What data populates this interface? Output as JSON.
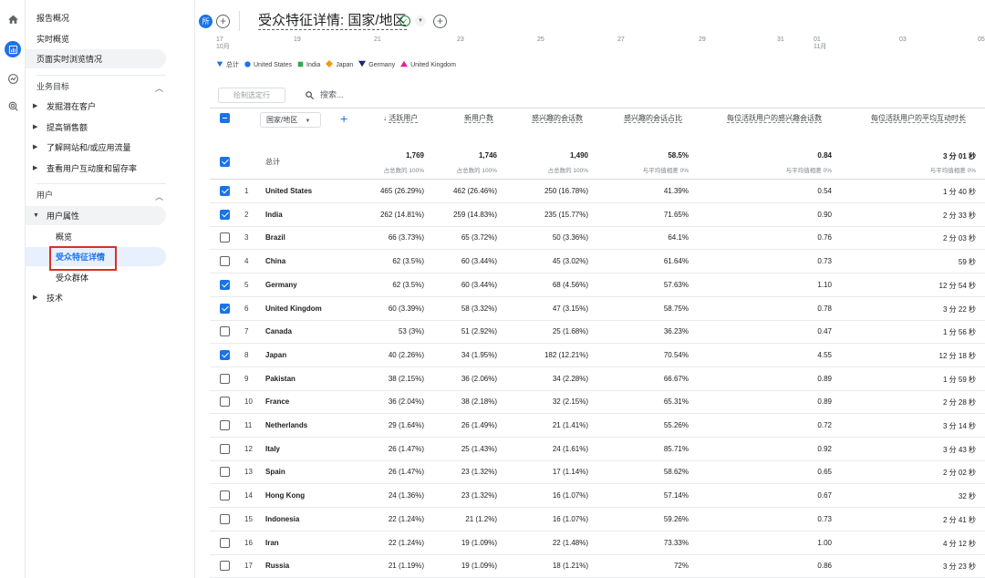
{
  "nav": {
    "top_items": [
      "报告概况",
      "实时概览",
      "页面实时浏览情况"
    ],
    "business": {
      "label": "业务目标",
      "items": [
        "发掘潜在客户",
        "提高销售额",
        "了解网站和/或应用流量",
        "查看用户互动度和留存率"
      ]
    },
    "user": {
      "label": "用户",
      "attr_label": "用户属性",
      "sub_items": [
        "概览",
        "受众特征详情",
        "受众群体"
      ],
      "tech_label": "技术"
    }
  },
  "header": {
    "badge": "所",
    "title": "受众特征详情: 国家/地区"
  },
  "timeline": {
    "ticks": [
      {
        "label": "17",
        "sub": "10月"
      },
      {
        "label": "19",
        "sub": ""
      },
      {
        "label": "21",
        "sub": ""
      },
      {
        "label": "23",
        "sub": ""
      },
      {
        "label": "25",
        "sub": ""
      },
      {
        "label": "27",
        "sub": ""
      },
      {
        "label": "29",
        "sub": ""
      },
      {
        "label": "31",
        "sub": ""
      },
      {
        "label": "01",
        "sub": "11月"
      },
      {
        "label": "03",
        "sub": ""
      },
      {
        "label": "05",
        "sub": ""
      }
    ],
    "legend": [
      {
        "name": "总计",
        "color": "#1a73e8",
        "marker": "pin"
      },
      {
        "name": "United States",
        "color": "#1a73e8",
        "marker": "circle"
      },
      {
        "name": "India",
        "color": "#34a853",
        "marker": "square"
      },
      {
        "name": "Japan",
        "color": "#f29900",
        "marker": "diamond"
      },
      {
        "name": "Germany",
        "color": "#1a237e",
        "marker": "tri-down"
      },
      {
        "name": "United Kingdom",
        "color": "#e52592",
        "marker": "tri-up"
      }
    ]
  },
  "toolbar": {
    "plot_rows": "绘制选定行",
    "search_placeholder": "搜索..."
  },
  "table": {
    "dimension": "国家/地区",
    "headers": [
      "活跃用户",
      "新用户数",
      "感兴趣的会话数",
      "感兴趣的会话占比",
      "每位活跃用户的感兴趣会话数",
      "每位活跃用户的平均互动时长"
    ],
    "sort_arrow": "↓",
    "totals": {
      "label": "总计",
      "values": [
        "1,769",
        "1,746",
        "1,490",
        "58.5%",
        "0.84",
        "3 分 01 秒"
      ],
      "subs": [
        "占总数的 100%",
        "占总数的 100%",
        "占总数的 100%",
        "与平均值相差 0%",
        "与平均值相差 0%",
        "与平均值相差 0%"
      ]
    },
    "rows": [
      {
        "idx": "1",
        "name": "United States",
        "checked": true,
        "values": [
          "465 (26.29%)",
          "462 (26.46%)",
          "250 (16.78%)",
          "41.39%",
          "0.54",
          "1 分 40 秒"
        ]
      },
      {
        "idx": "2",
        "name": "India",
        "checked": true,
        "values": [
          "262 (14.81%)",
          "259 (14.83%)",
          "235 (15.77%)",
          "71.65%",
          "0.90",
          "2 分 33 秒"
        ]
      },
      {
        "idx": "3",
        "name": "Brazil",
        "checked": false,
        "values": [
          "66 (3.73%)",
          "65 (3.72%)",
          "50 (3.36%)",
          "64.1%",
          "0.76",
          "2 分 03 秒"
        ]
      },
      {
        "idx": "4",
        "name": "China",
        "checked": false,
        "values": [
          "62 (3.5%)",
          "60 (3.44%)",
          "45 (3.02%)",
          "61.64%",
          "0.73",
          "59 秒"
        ]
      },
      {
        "idx": "5",
        "name": "Germany",
        "checked": true,
        "values": [
          "62 (3.5%)",
          "60 (3.44%)",
          "68 (4.56%)",
          "57.63%",
          "1.10",
          "12 分 54 秒"
        ]
      },
      {
        "idx": "6",
        "name": "United Kingdom",
        "checked": true,
        "values": [
          "60 (3.39%)",
          "58 (3.32%)",
          "47 (3.15%)",
          "58.75%",
          "0.78",
          "3 分 22 秒"
        ]
      },
      {
        "idx": "7",
        "name": "Canada",
        "checked": false,
        "values": [
          "53 (3%)",
          "51 (2.92%)",
          "25 (1.68%)",
          "36.23%",
          "0.47",
          "1 分 56 秒"
        ]
      },
      {
        "idx": "8",
        "name": "Japan",
        "checked": true,
        "values": [
          "40 (2.26%)",
          "34 (1.95%)",
          "182 (12.21%)",
          "70.54%",
          "4.55",
          "12 分 18 秒"
        ]
      },
      {
        "idx": "9",
        "name": "Pakistan",
        "checked": false,
        "values": [
          "38 (2.15%)",
          "36 (2.06%)",
          "34 (2.28%)",
          "66.67%",
          "0.89",
          "1 分 59 秒"
        ]
      },
      {
        "idx": "10",
        "name": "France",
        "checked": false,
        "values": [
          "36 (2.04%)",
          "38 (2.18%)",
          "32 (2.15%)",
          "65.31%",
          "0.89",
          "2 分 28 秒"
        ]
      },
      {
        "idx": "11",
        "name": "Netherlands",
        "checked": false,
        "values": [
          "29 (1.64%)",
          "26 (1.49%)",
          "21 (1.41%)",
          "55.26%",
          "0.72",
          "3 分 14 秒"
        ]
      },
      {
        "idx": "12",
        "name": "Italy",
        "checked": false,
        "values": [
          "26 (1.47%)",
          "25 (1.43%)",
          "24 (1.61%)",
          "85.71%",
          "0.92",
          "3 分 43 秒"
        ]
      },
      {
        "idx": "13",
        "name": "Spain",
        "checked": false,
        "values": [
          "26 (1.47%)",
          "23 (1.32%)",
          "17 (1.14%)",
          "58.62%",
          "0.65",
          "2 分 02 秒"
        ]
      },
      {
        "idx": "14",
        "name": "Hong Kong",
        "checked": false,
        "values": [
          "24 (1.36%)",
          "23 (1.32%)",
          "16 (1.07%)",
          "57.14%",
          "0.67",
          "32 秒"
        ]
      },
      {
        "idx": "15",
        "name": "Indonesia",
        "checked": false,
        "values": [
          "22 (1.24%)",
          "21 (1.2%)",
          "16 (1.07%)",
          "59.26%",
          "0.73",
          "2 分 41 秒"
        ]
      },
      {
        "idx": "16",
        "name": "Iran",
        "checked": false,
        "values": [
          "22 (1.24%)",
          "19 (1.09%)",
          "22 (1.48%)",
          "73.33%",
          "1.00",
          "4 分 12 秒"
        ]
      },
      {
        "idx": "17",
        "name": "Russia",
        "checked": false,
        "values": [
          "21 (1.19%)",
          "19 (1.09%)",
          "18 (1.21%)",
          "72%",
          "0.86",
          "3 分 23 秒"
        ]
      }
    ]
  },
  "colors": {
    "accent": "#1a73e8",
    "highlight_border": "#d93025",
    "check_ok": "#188038"
  }
}
